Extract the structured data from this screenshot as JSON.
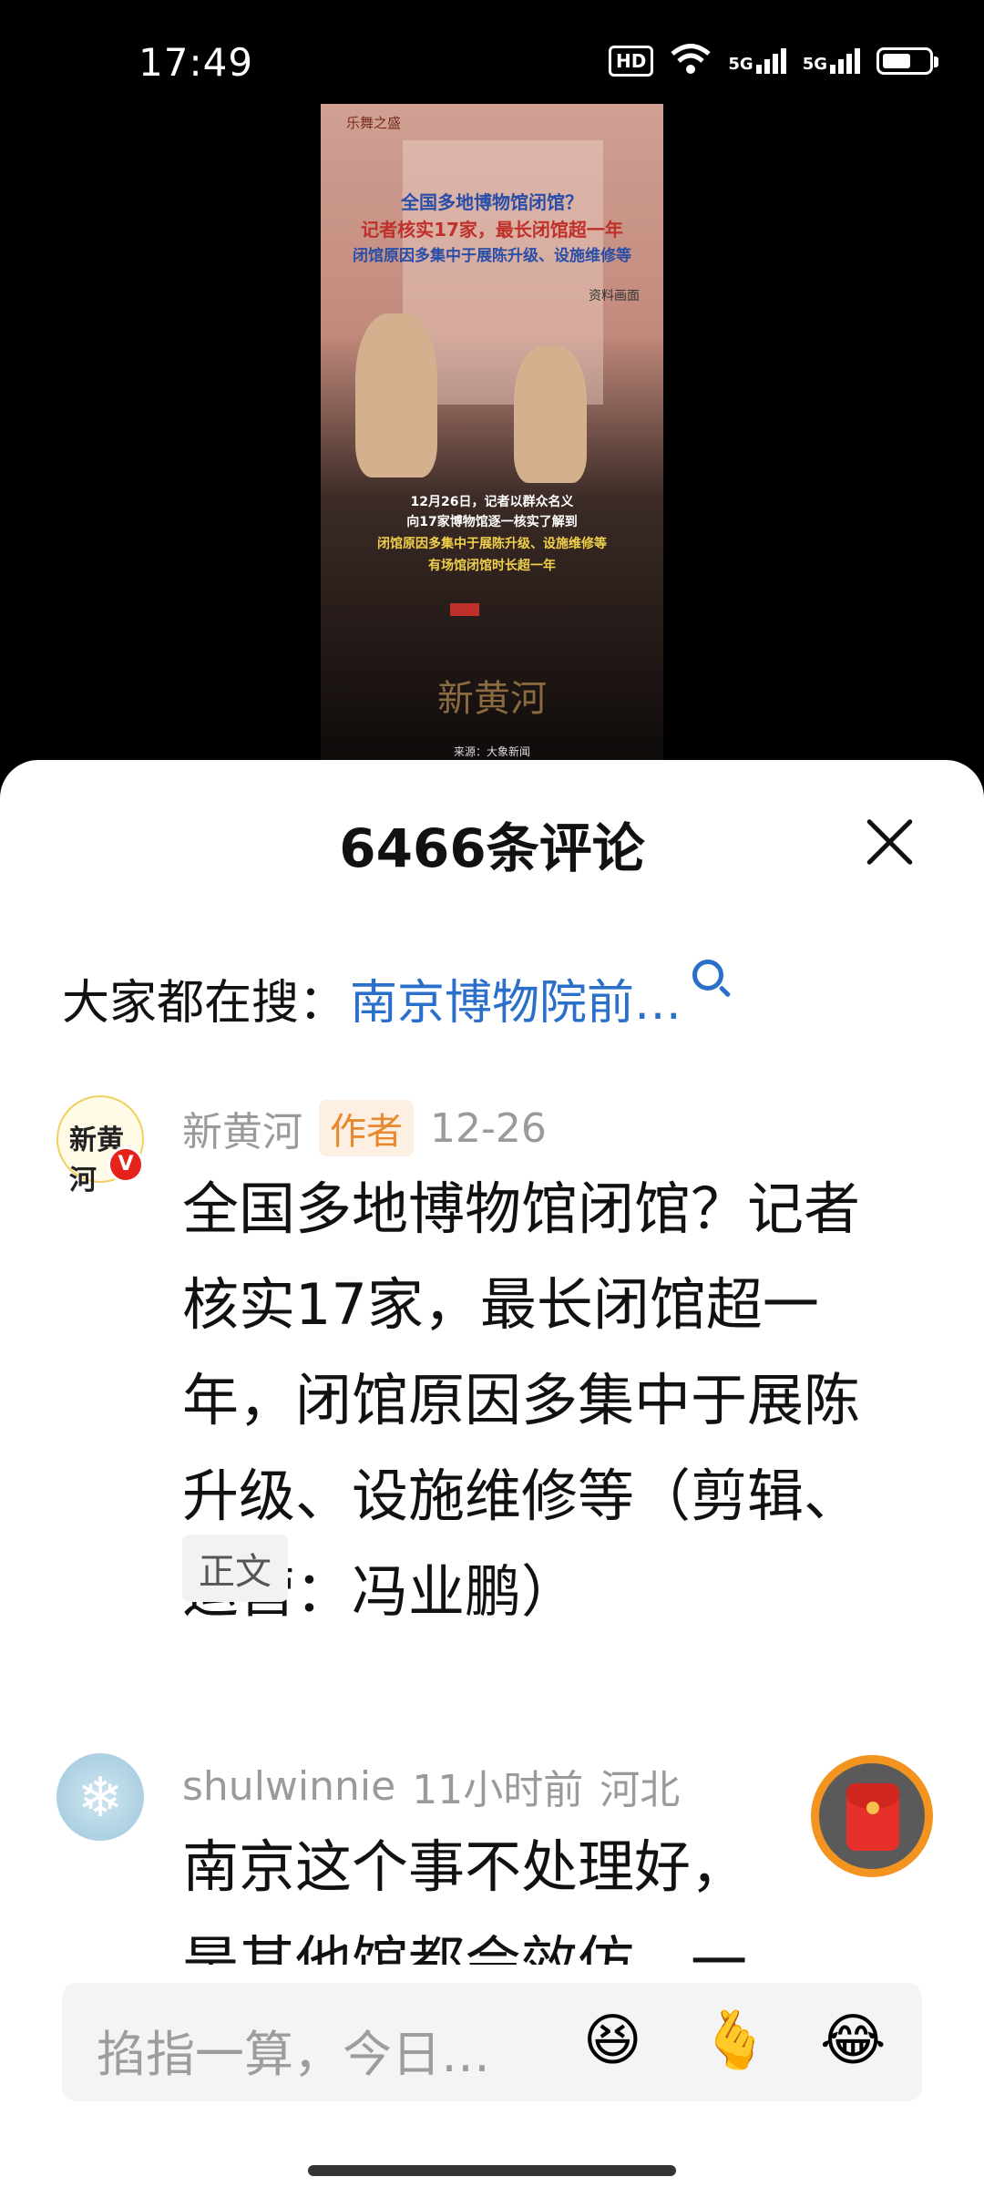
{
  "status_bar": {
    "time": "17:49",
    "hd_label": "HD",
    "net1": "5G",
    "net2": "5G",
    "battery_level": 0.6
  },
  "video": {
    "exhibit_tag": "乐舞之盛",
    "title_line1": "全国多地博物馆闭馆？",
    "title_line2": "记者核实17家，最长闭馆超一年",
    "title_line3": "闭馆原因多集中于展陈升级、设施维修等",
    "source_note": "资料画面",
    "caption_line1": "12月26日，记者以群众名义",
    "caption_line2": "向17家博物馆逐一核实了解到",
    "caption_line3": "闭馆原因多集中于展陈升级、设施维修等",
    "caption_line4": "有场馆闭馆时长超一年",
    "logo_text": "新黄河",
    "source_text": "来源：大象新闻"
  },
  "sheet": {
    "title": "6466条评论"
  },
  "search": {
    "prefix": "大家都在搜：",
    "query": "南京博物院前…"
  },
  "comments": [
    {
      "avatar_text": "新黄河",
      "verified": "V",
      "username": "新黄河",
      "badge": "作者",
      "date": "12-26",
      "text": "全国多地博物馆闭馆？记者核实17家，最长闭馆超一年，闭馆原因多集中于展陈升级、设施维修等（剪辑、运营：冯业鹏）",
      "tag": "正文"
    },
    {
      "username": "shulwinnie",
      "time": "11小时前",
      "location": "河北",
      "text": "南京这个事不处理好，是其他馆都会效仿，一是"
    }
  ],
  "input": {
    "placeholder": "掐指一算，今日…",
    "emoji1": "😆",
    "emoji2": "🫰",
    "emoji3": "😂"
  }
}
